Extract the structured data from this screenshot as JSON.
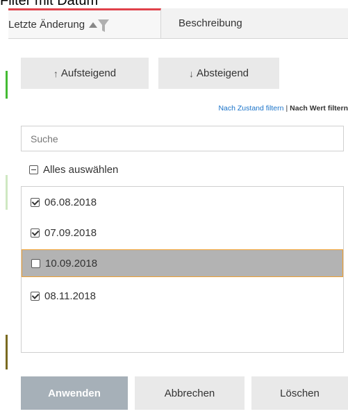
{
  "page": {
    "title": "Filter mit Datum"
  },
  "table_header": {
    "columns": [
      {
        "label": "Letzte Änderung",
        "sorted": "ascending",
        "filtered": true
      },
      {
        "label": "Beschreibung"
      }
    ]
  },
  "filter_panel": {
    "sort_ascending_label": "Aufsteigend",
    "sort_descending_label": "Absteigend",
    "sort_ascending_arrow": "↑",
    "sort_descending_arrow": "↓",
    "filter_by_state_label": "Nach Zustand filtern",
    "separator": "|",
    "filter_by_value_label": "Nach Wert filtern",
    "search_placeholder": "Suche",
    "select_all_label": "Alles auswählen",
    "select_all_state": "partial",
    "values": [
      {
        "label": "06.08.2018",
        "checked": true,
        "selected": false
      },
      {
        "label": "07.09.2018",
        "checked": true,
        "selected": false
      },
      {
        "label": "10.09.2018",
        "checked": false,
        "selected": true
      },
      {
        "label": "08.11.2018",
        "checked": true,
        "selected": false
      }
    ],
    "apply_label": "Anwenden",
    "cancel_label": "Abbrechen",
    "clear_label": "Löschen"
  },
  "colors": {
    "active_column_accent": "#e0414a",
    "link": "#1a73c9",
    "selected_row_bg": "#b3b3b3",
    "selected_row_border": "#f0a030",
    "apply_button_bg": "#a6b0b8"
  }
}
